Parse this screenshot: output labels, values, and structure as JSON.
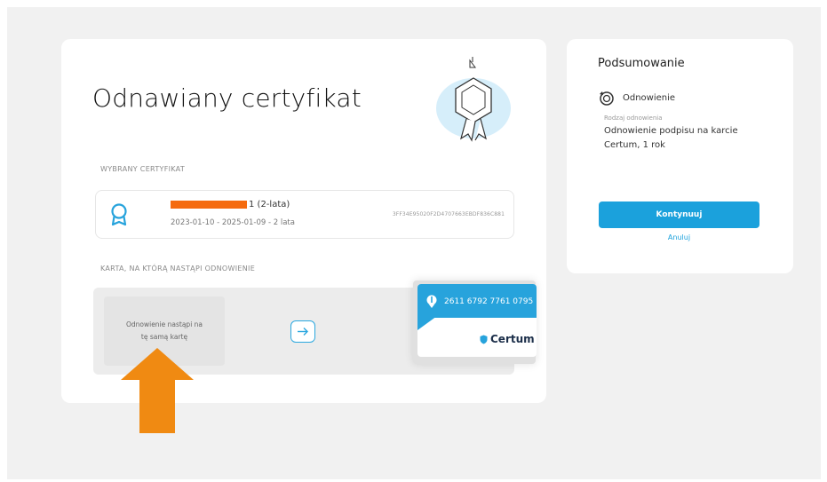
{
  "main": {
    "title": "Odnawiany certyfikat",
    "selected_section_label": "WYBRANY CERTYFIKAT",
    "certificate": {
      "name_suffix": "1 (2-lata)",
      "dates": "2023-01-10 - 2025-01-09 - 2 lata",
      "hash": "3FF34E95020F2D4707663EBDF836C881"
    },
    "card_section_label": "KARTA, NA KTÓRĄ NASTĄPI ODNOWIENIE",
    "same_card_line1": "Odnowienie nastąpi na",
    "same_card_line2": "tę samą kartę",
    "card": {
      "number": "2611 6792 7761 0795",
      "brand": "Certum"
    }
  },
  "summary": {
    "title": "Podsumowanie",
    "renewal_label": "Odnowienie",
    "type_label": "Rodzaj odnowienia",
    "type_value": "Odnowienie podpisu na karcie Certum, 1 rok",
    "continue_label": "Kontynuuj",
    "cancel_label": "Anuluj"
  },
  "colors": {
    "accent": "#1ba1dc",
    "card_blue": "#27a3dc",
    "highlight_arrow": "#f08a12",
    "redaction": "#f56b0f"
  },
  "icons": {
    "hero": "certificate-badge-illustration",
    "certificate": "certificate-ribbon-icon",
    "arrow": "arrow-right-icon",
    "renewal": "renew-icon",
    "annotation": "arrow-up-annotation"
  }
}
